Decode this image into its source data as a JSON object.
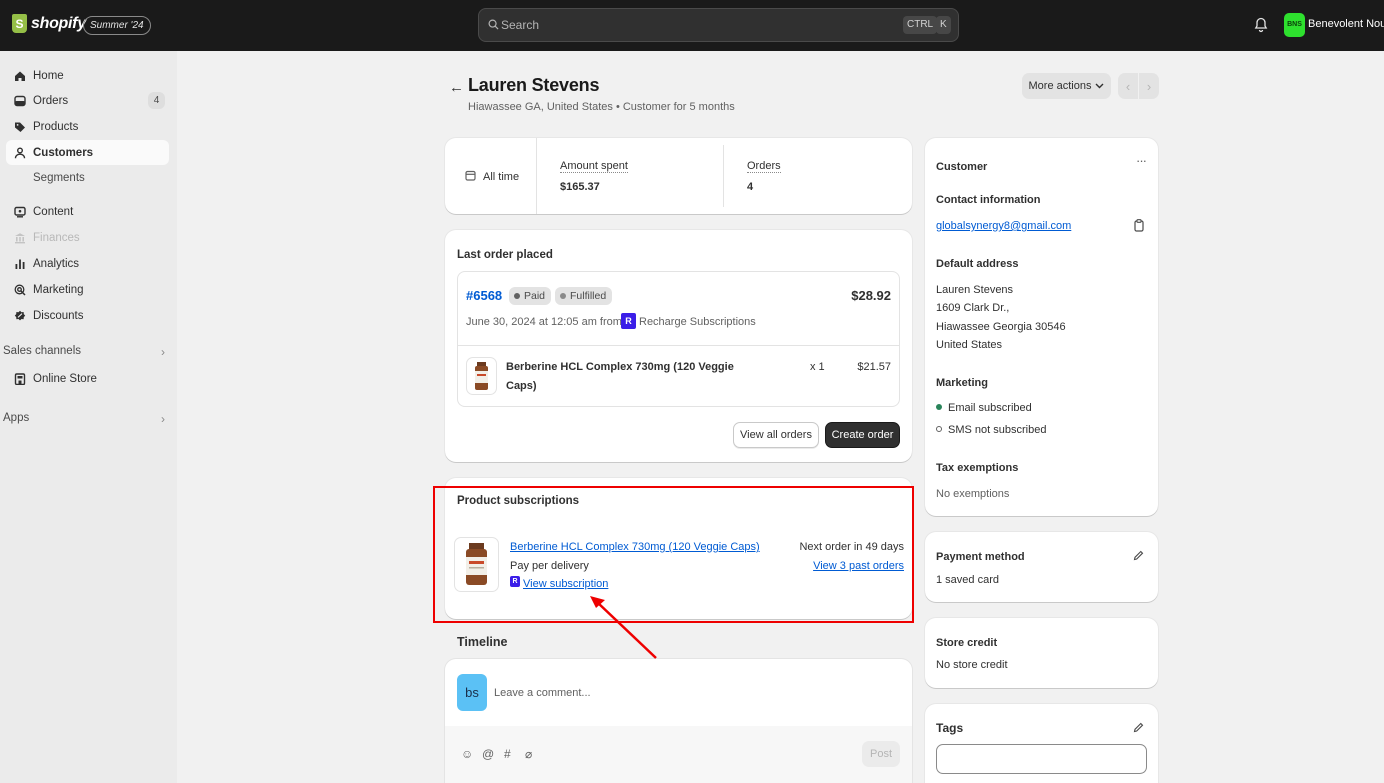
{
  "topbar": {
    "logo_text": "shopify",
    "edition": "Summer '24",
    "search_placeholder": "Search",
    "shortcut_ctrl": "CTRL",
    "shortcut_k": "K",
    "store_initials": "BNS",
    "store_name": "Benevolent Nouri"
  },
  "sidebar": {
    "items": [
      {
        "label": "Home",
        "icon": "home-icon"
      },
      {
        "label": "Orders",
        "icon": "orders-icon",
        "count": "4"
      },
      {
        "label": "Products",
        "icon": "tag-icon"
      },
      {
        "label": "Customers",
        "icon": "person-icon",
        "active": true
      },
      {
        "label": "Segments",
        "sub": true
      },
      {
        "label": "Content",
        "icon": "content-icon"
      },
      {
        "label": "Finances",
        "icon": "bank-icon",
        "disabled": true
      },
      {
        "label": "Analytics",
        "icon": "chart-icon"
      },
      {
        "label": "Marketing",
        "icon": "target-icon"
      },
      {
        "label": "Discounts",
        "icon": "discount-icon"
      }
    ],
    "sales_channels": "Sales channels",
    "online_store": "Online Store",
    "apps": "Apps"
  },
  "header": {
    "back_glyph": "←",
    "title": "Lauren Stevens",
    "subtitle": "Hiawassee GA, United States • Customer for 5 months",
    "more_actions": "More actions",
    "prev_glyph": "‹",
    "next_glyph": "›"
  },
  "stats": {
    "period": "All time",
    "amount_label": "Amount spent",
    "amount_value": "$165.37",
    "orders_label": "Orders",
    "orders_value": "4"
  },
  "last_order": {
    "title": "Last order placed",
    "order_number": "#6568",
    "payment_status": "Paid",
    "fulfillment_status": "Fulfilled",
    "total": "$28.92",
    "date_text": "June 30, 2024 at 12:05 am from",
    "source": "Recharge Subscriptions",
    "item_name_line1": "Berberine HCL Complex 730mg (120 Veggie",
    "item_name_line2": "Caps)",
    "item_qty": "x 1",
    "item_price": "$21.57",
    "view_all_button": "View all orders",
    "create_order_button": "Create order"
  },
  "subscriptions": {
    "title": "Product subscriptions",
    "product_link": "Berberine HCL Complex 730mg (120 Veggie Caps)",
    "plan": "Pay per delivery",
    "view_subscription": "View subscription",
    "next_order": "Next order in 49 days",
    "past_orders": "View 3 past orders"
  },
  "timeline": {
    "title": "Timeline",
    "avatar_initials": "bs",
    "comment_placeholder": "Leave a comment...",
    "post_button": "Post",
    "tools": [
      "☺",
      "@",
      "#",
      "⌀"
    ]
  },
  "customer_card": {
    "title": "Customer",
    "more_glyph": "···",
    "contact_title": "Contact information",
    "email": "globalsynergy8@gmail.com",
    "address_title": "Default address",
    "address_lines": [
      "Lauren Stevens",
      "1609 Clark Dr.,",
      "Hiawassee Georgia 30546",
      "United States"
    ],
    "marketing_title": "Marketing",
    "email_marketing": "Email subscribed",
    "sms_marketing": "SMS not subscribed",
    "tax_title": "Tax exemptions",
    "tax_value": "No exemptions"
  },
  "payment_card": {
    "title": "Payment method",
    "value": "1 saved card"
  },
  "store_credit_card": {
    "title": "Store credit",
    "value": "No store credit"
  },
  "tags_card": {
    "title": "Tags"
  },
  "colors": {
    "link": "#005bd3",
    "highlight": "#ee0000",
    "subscribed_dot": "#29845a",
    "topbar": "#1a1a1a",
    "sidebar": "#ebebeb",
    "page_bg": "#f1f1f1"
  }
}
